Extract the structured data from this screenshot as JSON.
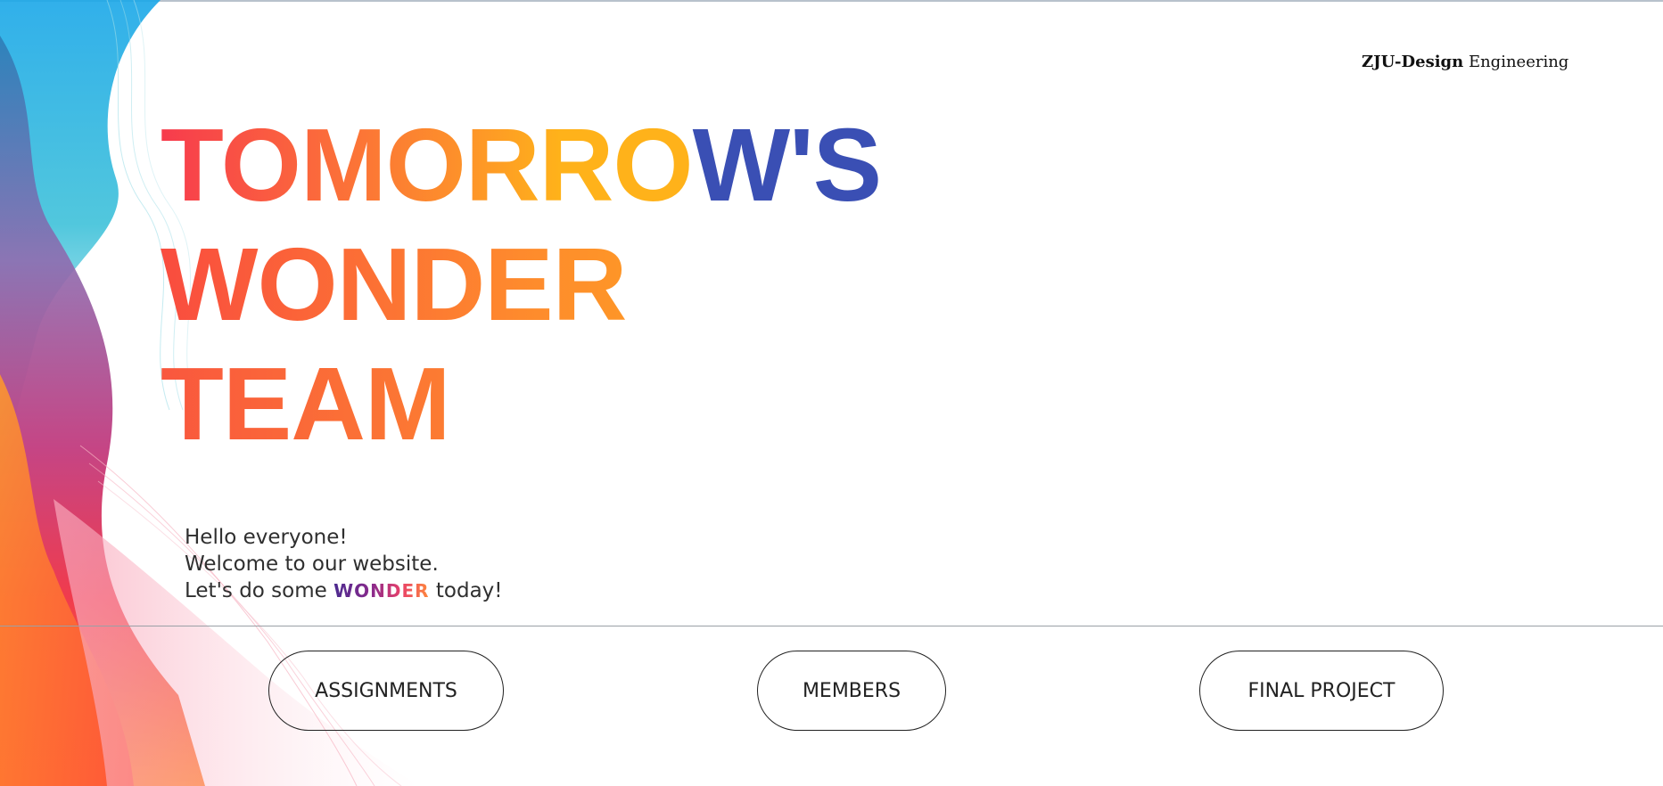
{
  "header": {
    "brand_bold": "ZJU-Design",
    "brand_regular": " Engineering"
  },
  "hero": {
    "line1_part1": "TOMORRO",
    "line1_part2": "W'S",
    "line2": "WONDER",
    "line3": "TEAM"
  },
  "welcome": {
    "line1": "Hello everyone!",
    "line2": "Welcome to our website.",
    "line3_prefix": "Let's do some ",
    "line3_highlight": "WONDER",
    "line3_suffix": " today!"
  },
  "nav": {
    "assignments_label": "ASSIGNMENTS",
    "members_label": "MEMBERS",
    "final_project_label": "FINAL PROJECT"
  },
  "colors": {
    "headline_red": "#f73b4d",
    "headline_orange": "#fd8f2b",
    "headline_yellow": "#ffb21a",
    "headline_blue": "#3a4fb4",
    "text": "#2f2f2f"
  }
}
